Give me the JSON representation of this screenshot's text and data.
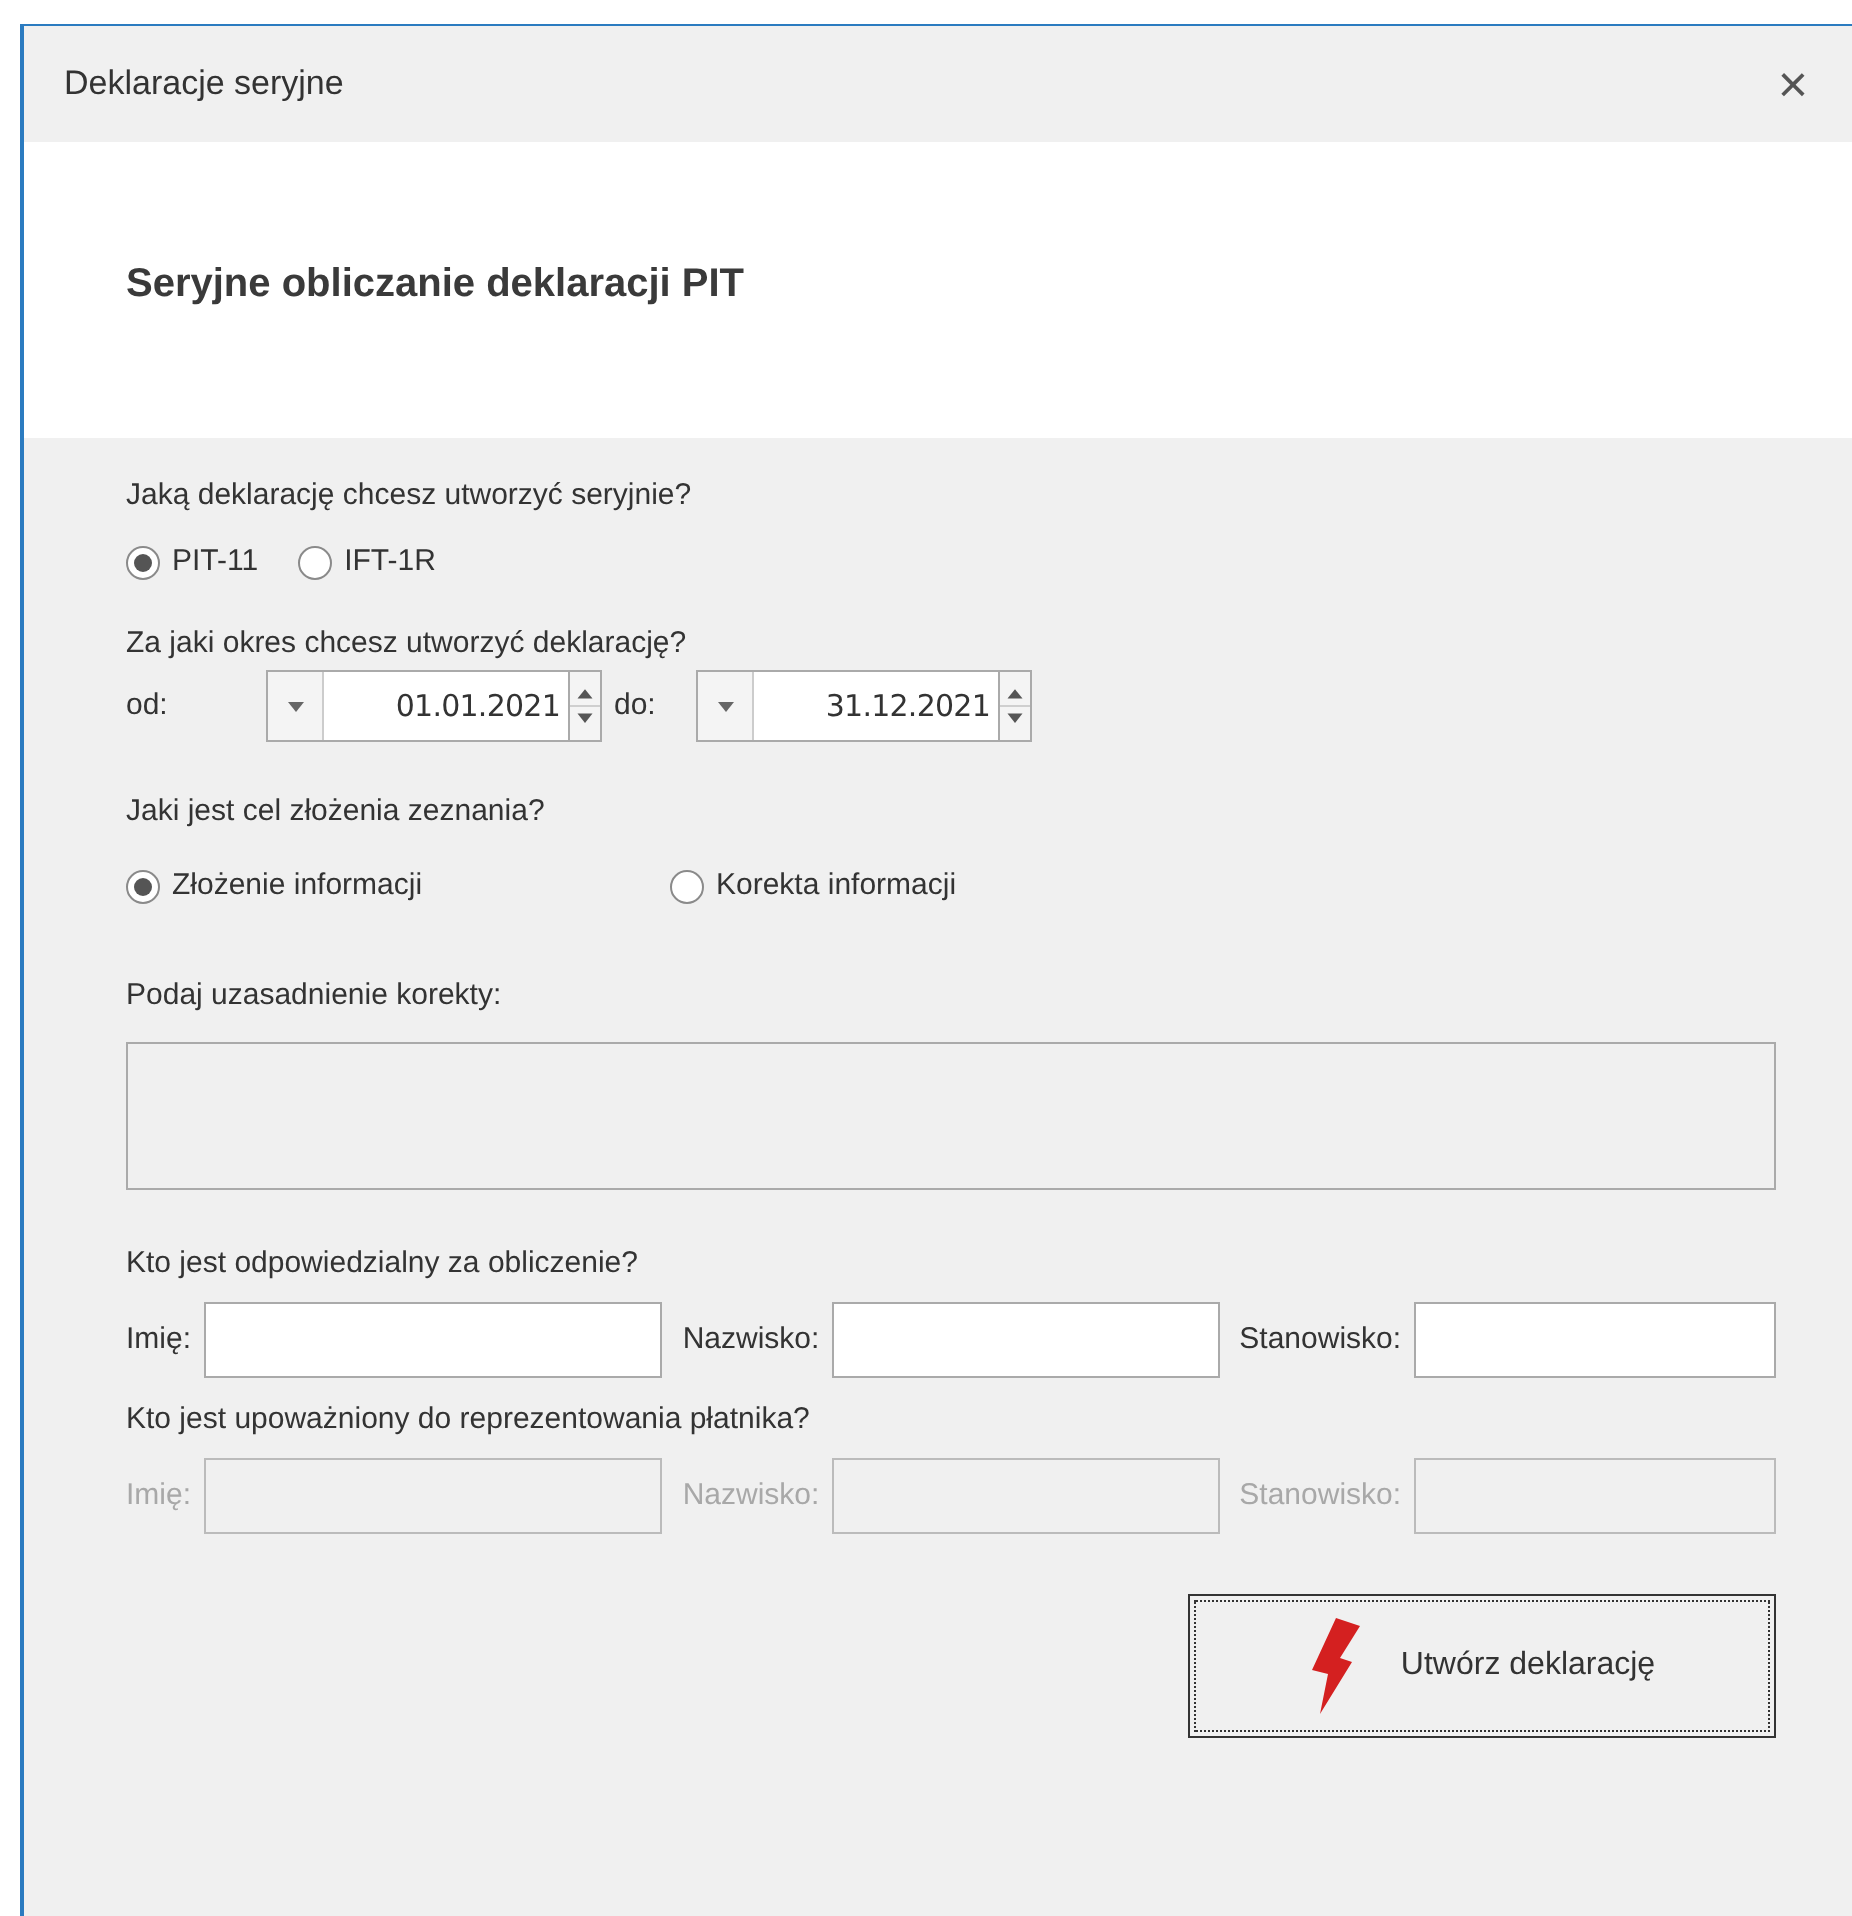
{
  "window": {
    "title": "Deklaracje seryjne",
    "close": "×"
  },
  "header": {
    "title": "Seryjne obliczanie deklaracji PIT"
  },
  "declaration": {
    "question": "Jaką deklarację chcesz utworzyć seryjnie?",
    "options": [
      {
        "label": "PIT-11",
        "selected": true
      },
      {
        "label": "IFT-1R",
        "selected": false
      }
    ]
  },
  "period": {
    "question": "Za jaki okres chcesz utworzyć deklarację?",
    "fields": [
      {
        "label": "od:",
        "value": "01.01.2021"
      },
      {
        "label": "do:",
        "value": "31.12.2021"
      }
    ]
  },
  "purpose": {
    "question": "Jaki jest cel złożenia zeznania?",
    "options": [
      {
        "label": "Złożenie informacji",
        "selected": true
      },
      {
        "label": "Korekta informacji",
        "selected": false
      }
    ]
  },
  "justification": {
    "label": "Podaj uzasadnienie korekty:",
    "disabled": true
  },
  "people": [
    {
      "question": "Kto jest odpowiedzialny za obliczenie?",
      "disabled": false,
      "fields": [
        {
          "label": "Imię:"
        },
        {
          "label": "Nazwisko:"
        },
        {
          "label": "Stanowisko:"
        }
      ]
    },
    {
      "question": "Kto jest upoważniony do reprezentowania płatnika?",
      "disabled": true,
      "fields": [
        {
          "label": "Imię:"
        },
        {
          "label": "Nazwisko:"
        },
        {
          "label": "Stanowisko:"
        }
      ]
    }
  ],
  "button": {
    "label": "Utwórz deklarację"
  }
}
